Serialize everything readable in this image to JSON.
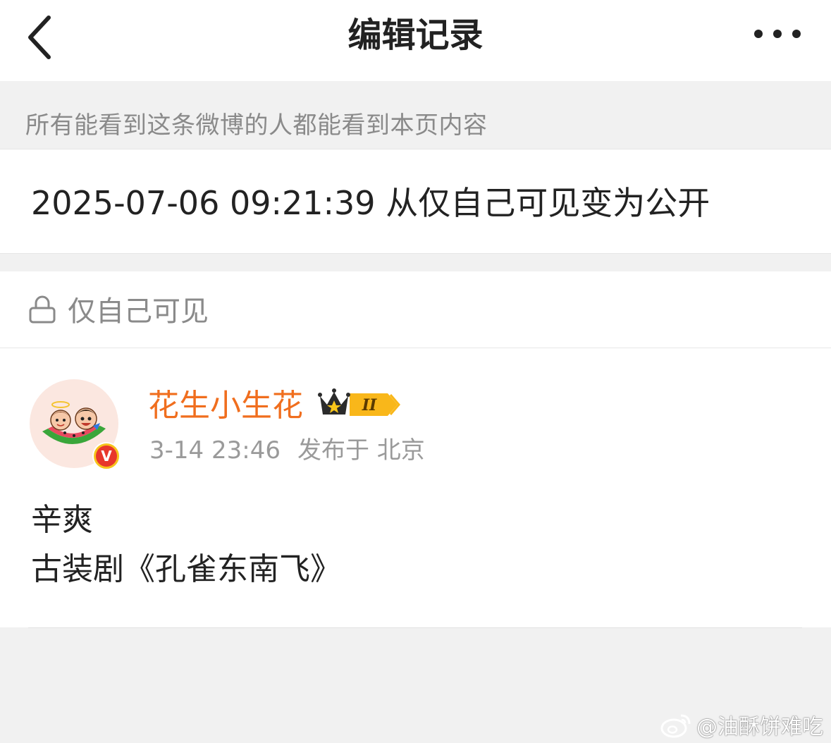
{
  "header": {
    "title": "编辑记录",
    "back_icon": "chevron-left-icon",
    "more_icon": "more-horizontal-icon"
  },
  "notice": "所有能看到这条微博的人都能看到本页内容",
  "change": {
    "timestamp": "2025-07-06 09:21:39",
    "description": "从仅自己可见变为公开"
  },
  "visibility": {
    "icon": "lock-icon",
    "label": "仅自己可见"
  },
  "post": {
    "username": "花生小生花",
    "vip_level": "II",
    "verified_mark": "V",
    "time": "3-14 23:46",
    "location": "发布于 北京",
    "lines": [
      "辛爽",
      "古装剧《孔雀东南飞》"
    ]
  },
  "watermark": "@油酥饼难吃",
  "colors": {
    "username": "#f06e1e",
    "badge_gold": "#f7c31c",
    "badge_red": "#e8372b"
  }
}
